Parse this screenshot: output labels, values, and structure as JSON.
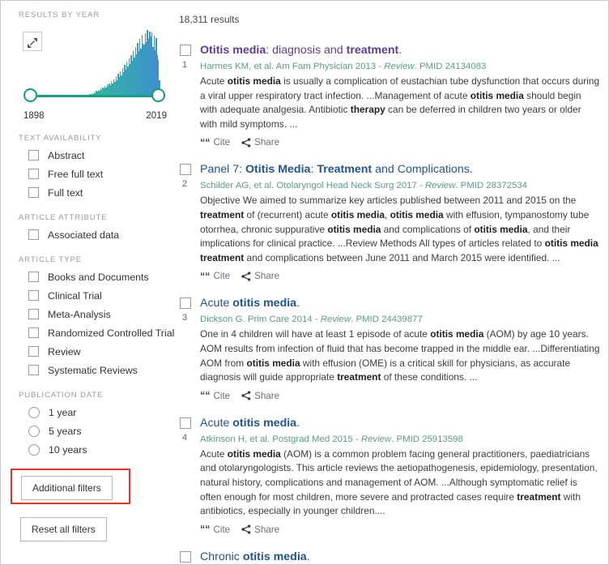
{
  "sidebar": {
    "results_by_year": {
      "heading": "RESULTS BY YEAR",
      "expand_icon": "expand-diagonal-icon",
      "year_min": "1898",
      "year_max": "2019"
    },
    "text_availability": {
      "heading": "TEXT AVAILABILITY",
      "items": [
        {
          "label": "Abstract",
          "checked": false
        },
        {
          "label": "Free full text",
          "checked": false
        },
        {
          "label": "Full text",
          "checked": false
        }
      ]
    },
    "article_attribute": {
      "heading": "ARTICLE ATTRIBUTE",
      "items": [
        {
          "label": "Associated data",
          "checked": false
        }
      ]
    },
    "article_type": {
      "heading": "ARTICLE TYPE",
      "items": [
        {
          "label": "Books and Documents",
          "checked": false
        },
        {
          "label": "Clinical Trial",
          "checked": false
        },
        {
          "label": "Meta-Analysis",
          "checked": false
        },
        {
          "label": "Randomized Controlled Trial",
          "checked": false
        },
        {
          "label": "Review",
          "checked": false
        },
        {
          "label": "Systematic Reviews",
          "checked": false
        }
      ]
    },
    "publication_date": {
      "heading": "PUBLICATION DATE",
      "items": [
        {
          "label": "1 year",
          "selected": false
        },
        {
          "label": "5 years",
          "selected": false
        },
        {
          "label": "10 years",
          "selected": false
        }
      ]
    },
    "additional_filters_label": "Additional filters",
    "reset_all_label": "Reset all filters",
    "highlight_color": "#ee3124"
  },
  "results_header": {
    "count_text": "18,311 results"
  },
  "actions": {
    "cite_label": "Cite",
    "share_label": "Share"
  },
  "results": [
    {
      "number": "1",
      "title_color": "purple",
      "title_parts": [
        {
          "t": "Otitis media",
          "b": true
        },
        {
          "t": ": diagnosis and ",
          "b": false
        },
        {
          "t": "treatment",
          "b": true
        },
        {
          "t": ".",
          "b": false
        }
      ],
      "citation_pre": "Harmes KM, et al. Am Fam Physician 2013 - ",
      "citation_italic": "Review",
      "citation_post": ". PMID 24134083",
      "snippet_parts": [
        {
          "t": "Acute ",
          "b": false
        },
        {
          "t": "otitis media",
          "b": true
        },
        {
          "t": " is usually a complication of eustachian tube dysfunction that occurs during a viral upper respiratory tract infection. ...Management of acute ",
          "b": false
        },
        {
          "t": "otitis media",
          "b": true
        },
        {
          "t": " should begin with adequate analgesia. Antibiotic ",
          "b": false
        },
        {
          "t": "therapy",
          "b": true
        },
        {
          "t": " can be deferred in children two years or older with mild symptoms. ...",
          "b": false
        }
      ]
    },
    {
      "number": "2",
      "title_color": "blue",
      "title_parts": [
        {
          "t": "Panel 7: ",
          "b": false
        },
        {
          "t": "Otitis Media",
          "b": true
        },
        {
          "t": ": ",
          "b": false
        },
        {
          "t": "Treatment",
          "b": true
        },
        {
          "t": " and Complications.",
          "b": false
        }
      ],
      "citation_pre": "Schilder AG, et al. Otolaryngol Head Neck Surg 2017 - ",
      "citation_italic": "Review",
      "citation_post": ". PMID 28372534",
      "snippet_parts": [
        {
          "t": "Objective We aimed to summarize key articles published between 2011 and 2015 on the ",
          "b": false
        },
        {
          "t": "treatment",
          "b": true
        },
        {
          "t": " of (recurrent) acute ",
          "b": false
        },
        {
          "t": "otitis media",
          "b": true
        },
        {
          "t": ", ",
          "b": false
        },
        {
          "t": "otitis media",
          "b": true
        },
        {
          "t": " with effusion, tympanostomy tube otorrhea, chronic suppurative ",
          "b": false
        },
        {
          "t": "otitis media",
          "b": true
        },
        {
          "t": " and complications of ",
          "b": false
        },
        {
          "t": "otitis media",
          "b": true
        },
        {
          "t": ", and their implications for clinical practice. ...Review Methods All types of articles related to ",
          "b": false
        },
        {
          "t": "otitis media treatment",
          "b": true
        },
        {
          "t": " and complications between June 2011 and March 2015 were identified. ...",
          "b": false
        }
      ]
    },
    {
      "number": "3",
      "title_color": "blue",
      "title_parts": [
        {
          "t": "Acute ",
          "b": false
        },
        {
          "t": "otitis media",
          "b": true
        },
        {
          "t": ".",
          "b": false
        }
      ],
      "citation_pre": "Dickson G. Prim Care 2014 - ",
      "citation_italic": "Review",
      "citation_post": ". PMID 24439877",
      "snippet_parts": [
        {
          "t": "One in 4 children will have at least 1 episode of acute ",
          "b": false
        },
        {
          "t": "otitis media",
          "b": true
        },
        {
          "t": " (AOM) by age 10 years. AOM results from infection of fluid that has become trapped in the middle ear. ...Differentiating AOM from ",
          "b": false
        },
        {
          "t": "otitis media",
          "b": true
        },
        {
          "t": " with effusion (OME) is a critical skill for physicians, as accurate diagnosis will guide appropriate ",
          "b": false
        },
        {
          "t": "treatment",
          "b": true
        },
        {
          "t": " of these conditions. ...",
          "b": false
        }
      ]
    },
    {
      "number": "4",
      "title_color": "blue",
      "title_parts": [
        {
          "t": "Acute ",
          "b": false
        },
        {
          "t": "otitis media",
          "b": true
        },
        {
          "t": ".",
          "b": false
        }
      ],
      "citation_pre": "Atkinson H, et al. Postgrad Med 2015 - ",
      "citation_italic": "Review",
      "citation_post": ". PMID 25913598",
      "snippet_parts": [
        {
          "t": "Acute ",
          "b": false
        },
        {
          "t": "otitis media",
          "b": true
        },
        {
          "t": " (AOM) is a common problem facing general practitioners, paediatricians and otolaryngologists. This article reviews the aetiopathogenesis, epidemiology, presentation, natural history, complications and management of AOM. ...Although symptomatic relief is often enough for most children, more severe and protracted cases require ",
          "b": false
        },
        {
          "t": "treatment",
          "b": true
        },
        {
          "t": " with antibiotics, especially in younger children....",
          "b": false
        }
      ]
    },
    {
      "number": "",
      "title_color": "blue",
      "title_parts": [
        {
          "t": "Chronic ",
          "b": false
        },
        {
          "t": "otitis media",
          "b": true
        },
        {
          "t": ".",
          "b": false
        }
      ],
      "citation_pre": "",
      "citation_italic": "",
      "citation_post": "",
      "snippet_parts": []
    }
  ],
  "chart_data": {
    "type": "bar",
    "title": "RESULTS BY YEAR",
    "xlabel": "",
    "ylabel": "",
    "x_range": [
      1898,
      2019
    ],
    "tick_labels": [
      "1898",
      "2019"
    ],
    "grid": false,
    "legend": "none",
    "color_start": "#2fbf93",
    "color_end": "#3f8fd0",
    "values": [
      1,
      1,
      1,
      1,
      1,
      1,
      1,
      1,
      1,
      1,
      1,
      1,
      1,
      1,
      1,
      1,
      1,
      1,
      1,
      1,
      1,
      1,
      1,
      1,
      1,
      1,
      1,
      1,
      1,
      1,
      1,
      1,
      1,
      1,
      1,
      1,
      1,
      1,
      1,
      1,
      1,
      1,
      1,
      1,
      1,
      1,
      1,
      1,
      1,
      1,
      1,
      1,
      2,
      3,
      2,
      3,
      4,
      3,
      5,
      4,
      6,
      5,
      8,
      7,
      10,
      8,
      12,
      10,
      14,
      12,
      16,
      13,
      18,
      16,
      20,
      17,
      23,
      20,
      26,
      22,
      30,
      25,
      34,
      29,
      38,
      32,
      43,
      36,
      47,
      40,
      52,
      45,
      57,
      49,
      62,
      54,
      68,
      58,
      74,
      63,
      80,
      68,
      86,
      72,
      93,
      79,
      78,
      95,
      82,
      100,
      86,
      98,
      90,
      96,
      74,
      92,
      70,
      88,
      62,
      55,
      24
    ]
  }
}
